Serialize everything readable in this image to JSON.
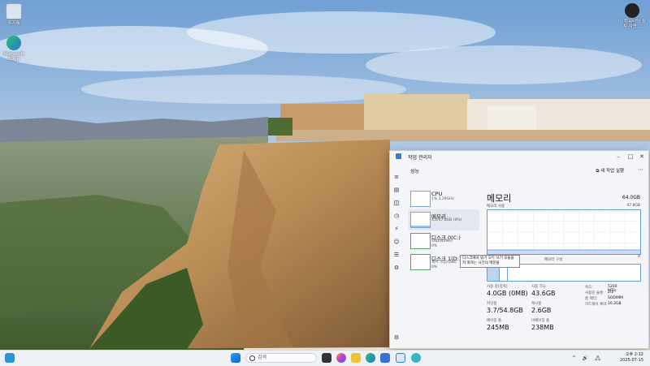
{
  "desktop": {
    "icons": [
      {
        "name": "recycle-bin",
        "label": "휴지통"
      },
      {
        "name": "edge",
        "label": "Microsoft Edge"
      }
    ],
    "corner_widget": {
      "label": "이 컴퓨터의 장치 사용..."
    }
  },
  "taskbar": {
    "search_placeholder": "검색",
    "clock_time": "오후 2:12",
    "clock_date": "2025-07-15",
    "tray_icons": "^ 🔊 🖧"
  },
  "task_manager": {
    "window_title": "작업 관리자",
    "page_title": "성능",
    "new_task_label": "새 작업 실행",
    "more_label": "⋯",
    "resources": [
      {
        "name": "CPU",
        "sub": "1% 3.29GHz"
      },
      {
        "name": "메모리",
        "sub": "4.2/47.8GB (9%)"
      },
      {
        "name": "디스크 0(C:)",
        "sub": "SSD(NVMe)\n0%"
      },
      {
        "name": "디스크 1(D:)",
        "sub": "제거 가능(USB)\n0%"
      }
    ],
    "detail": {
      "title": "메모리",
      "total": "64.0GB",
      "usage_label": "메모리 사용",
      "usage_max": "47.8GB",
      "axis_left": "60초",
      "axis_right": "0",
      "composition_label": "메모리 구성",
      "tooltip": "디스크에서 읽기 모두 쓰기 모듈을 저 좌하는 시간의 백분율",
      "in_use_label": "사용 중(압축)",
      "in_use_value": "4.0GB (0MB)",
      "available_label": "사용 가능",
      "available_value": "43.6GB",
      "committed_label": "커밋됨",
      "committed_value": "3.7/54.8GB",
      "cached_label": "캐시됨",
      "cached_value": "2.6GB",
      "paged_label": "페이징 풀",
      "paged_value": "245MB",
      "nonpaged_label": "비페이징 풀",
      "nonpaged_value": "238MB",
      "speed_label": "속도:",
      "speed_value": "5200 MT/s",
      "slots_label": "사용된 슬롯:",
      "slots_value": "2/2",
      "form_label": "폼 팩터:",
      "form_value": "SODIMM",
      "reserved_label": "하드웨어 예약:",
      "reserved_value": "16.2GB"
    }
  }
}
